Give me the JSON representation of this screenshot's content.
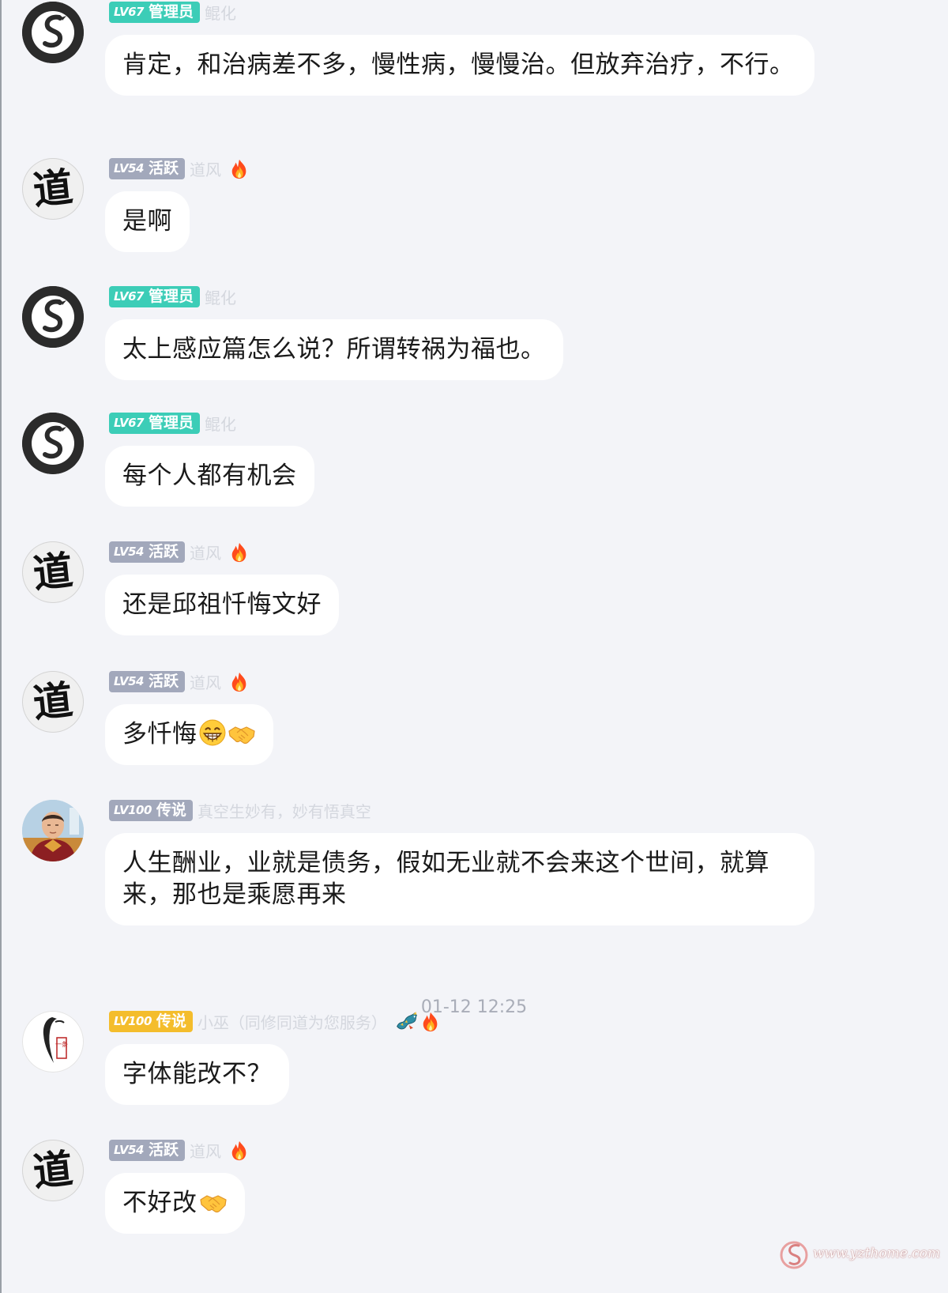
{
  "messages": [
    {
      "level": "LV67",
      "title": "管理员",
      "nickname": "鲲化",
      "avatar": "ink-swan-avatar",
      "text": "肯定，和治病差不多，慢性病，慢慢治。但放弃治疗，不行。",
      "icons": []
    },
    {
      "level": "LV54",
      "title": "活跃",
      "nickname": "道风",
      "avatar": "dao-calligraphy-avatar",
      "text": "是啊",
      "icons": [
        "fire-icon"
      ]
    },
    {
      "level": "LV67",
      "title": "管理员",
      "nickname": "鲲化",
      "avatar": "ink-swan-avatar",
      "text": "太上感应篇怎么说？所谓转祸为福也。",
      "icons": []
    },
    {
      "level": "LV67",
      "title": "管理员",
      "nickname": "鲲化",
      "avatar": "ink-swan-avatar",
      "text": "每个人都有机会",
      "icons": []
    },
    {
      "level": "LV54",
      "title": "活跃",
      "nickname": "道风",
      "avatar": "dao-calligraphy-avatar",
      "text": "还是邱祖忏悔文好",
      "icons": [
        "fire-icon"
      ]
    },
    {
      "level": "LV54",
      "title": "活跃",
      "nickname": "道风",
      "avatar": "dao-calligraphy-avatar",
      "text": "多忏悔",
      "icons": [
        "fire-icon"
      ],
      "emoji": [
        "grin-emoji",
        "handshake-emoji"
      ]
    },
    {
      "level": "LV100",
      "title": "传说",
      "nickname": "真空生妙有，妙有悟真空",
      "avatar": "monk-photo-avatar",
      "text": "人生酬业，业就是债务，假如无业就不会来这个世间，就算来，那也是乘愿再来",
      "icons": []
    },
    {
      "level": "LV100",
      "title": "传说",
      "nickname": "小巫（同修同道为您服务）",
      "avatar": "brush-calligraphy-avatar",
      "text": "字体能改不？",
      "icons": [
        "dragon-icon",
        "fire-icon"
      ]
    },
    {
      "level": "LV54",
      "title": "活跃",
      "nickname": "道风",
      "avatar": "dao-calligraphy-avatar",
      "text": "不好改",
      "icons": [
        "fire-icon"
      ],
      "emoji": [
        "handshake-emoji"
      ]
    }
  ],
  "timestamp": "01-12 12:25",
  "avatar_text": {
    "dao": "道",
    "brush_seal": "一条"
  },
  "watermark": "www.yzthome.com",
  "colors": {
    "background": "#f3f4f8",
    "bubble": "#ffffff",
    "badge_admin": "#3ccdb7",
    "badge_active": "#a2a8bb",
    "badge_legend_gold": "#f4bd2c",
    "timestamp": "#a9adb8",
    "flame": "#ff5a1f"
  }
}
